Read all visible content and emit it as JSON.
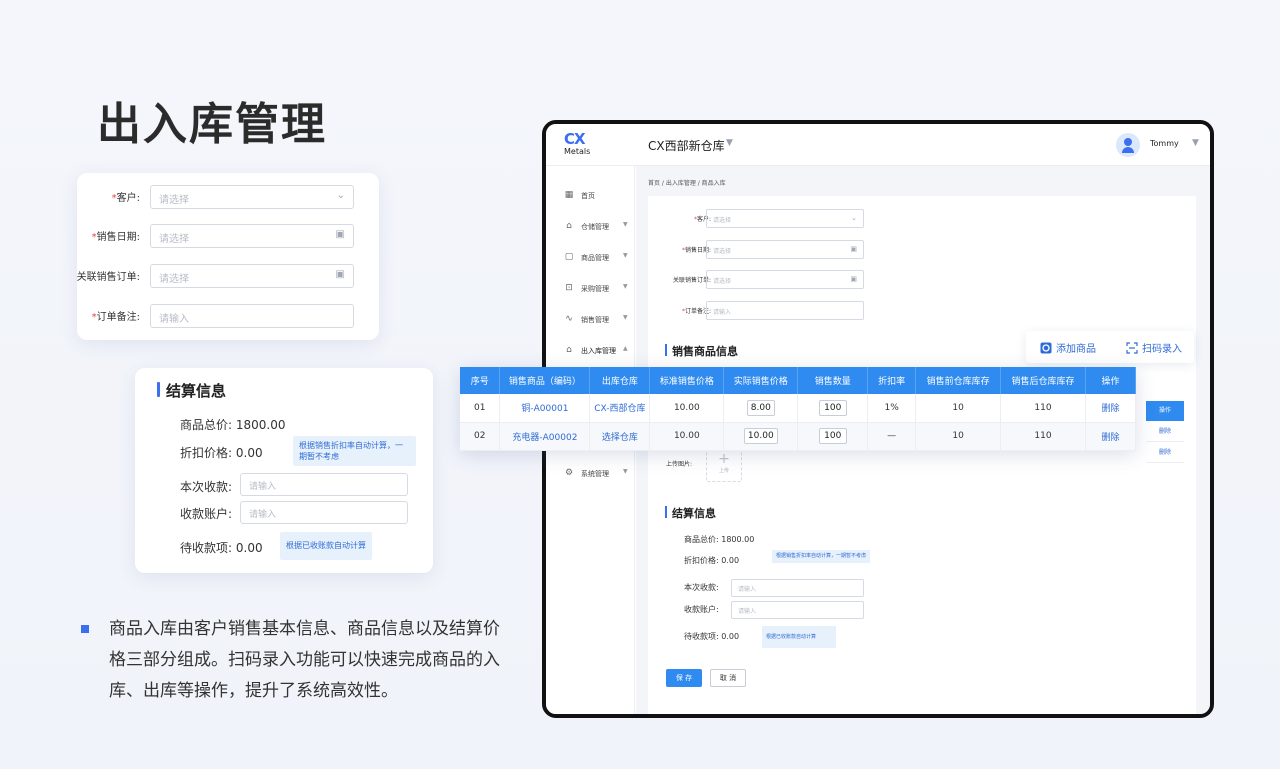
{
  "page_title": "出入库管理",
  "form_card": {
    "fields": [
      {
        "label": "客户:",
        "required": true,
        "placeholder": "请选择",
        "suffix_icon": "chevron-down-icon"
      },
      {
        "label": "销售日期:",
        "required": true,
        "placeholder": "请选择",
        "suffix_icon": "calendar-icon"
      },
      {
        "label": "关联销售订单:",
        "required": false,
        "placeholder": "请选择",
        "suffix_icon": "calendar-icon"
      },
      {
        "label": "订单备注:",
        "required": true,
        "placeholder": "请输入"
      }
    ]
  },
  "settle_card": {
    "title": "结算信息",
    "total_label": "商品总价:",
    "total_value": "1800.00",
    "discount_label": "折扣价格:",
    "discount_value": "0.00",
    "discount_hint": "根据销售折扣率自动计算，一期暂不考虑",
    "received_label": "本次收款:",
    "received_placeholder": "请输入",
    "account_label": "收款账户:",
    "account_placeholder": "请输入",
    "pending_label": "待收款项:",
    "pending_value": "0.00",
    "pending_hint": "根据已收账款自动计算"
  },
  "description": "商品入库由客户销售基本信息、商品信息以及结算价格三部分组成。扫码录入功能可以快速完成商品的入库、出库等操作，提升了系统高效性。",
  "app": {
    "logo_mark": "CX",
    "logo_text": "Metals",
    "warehouse": "CX西部新仓库",
    "user": "Tommy",
    "sidebar": [
      {
        "label": "首页",
        "icon": "grid-icon",
        "caret": false
      },
      {
        "label": "仓储管理",
        "icon": "warehouse-icon",
        "caret": true
      },
      {
        "label": "商品管理",
        "icon": "goods-icon",
        "caret": true
      },
      {
        "label": "采购管理",
        "icon": "cart-icon",
        "caret": true
      },
      {
        "label": "销售管理",
        "icon": "trend-icon",
        "caret": true
      },
      {
        "label": "出入库管理",
        "icon": "home-icon",
        "caret": true
      },
      {
        "label": "系统管理",
        "icon": "gear-icon",
        "caret": true
      }
    ],
    "breadcrumb": "首页 / 出入库管理 / 商品入库",
    "fields": [
      {
        "label": "客户:",
        "required": true,
        "placeholder": "请选择"
      },
      {
        "label": "销售日期:",
        "required": true,
        "placeholder": "请选择"
      },
      {
        "label": "关联销售订单:",
        "required": false,
        "placeholder": "请选择"
      },
      {
        "label": "订单备注:",
        "required": true,
        "placeholder": "请输入"
      }
    ],
    "goods_title": "销售商品信息",
    "upload_label": "上传图片:",
    "upload_text": "上传",
    "settle": {
      "title": "结算信息",
      "total_label": "商品总价:",
      "total_value": "1800.00",
      "discount_label": "折扣价格:",
      "discount_value": "0.00",
      "discount_hint": "根据销售折扣率自动计算，一期暂不考虑",
      "received_label": "本次收款:",
      "received_placeholder": "请输入",
      "account_label": "收款账户:",
      "account_placeholder": "请输入",
      "pending_label": "待收款项:",
      "pending_value": "0.00",
      "pending_hint": "根据已收账款自动计算"
    },
    "save": "保 存",
    "cancel": "取 消",
    "bg_table_header": "操作",
    "bg_table_action": "删除"
  },
  "toolbar": {
    "add": "添加商品",
    "scan": "扫码录入"
  },
  "goods_table": {
    "headers": [
      "序号",
      "销售商品（编码）",
      "出库仓库",
      "标准销售价格",
      "实际销售价格",
      "销售数量",
      "折扣率",
      "销售前仓库库存",
      "销售后仓库库存",
      "操作"
    ],
    "rows": [
      {
        "no": "01",
        "item": "铜-A00001",
        "warehouse": "CX-西部仓库",
        "std_price": "10.00",
        "actual_price": "8.00",
        "qty": "100",
        "discount": "1%",
        "stock_before": "10",
        "stock_after": "110",
        "action": "删除"
      },
      {
        "no": "02",
        "item": "充电器-A00002",
        "warehouse": "选择仓库",
        "std_price": "10.00",
        "actual_price": "10.00",
        "qty": "100",
        "discount": "—",
        "stock_before": "10",
        "stock_after": "110",
        "action": "删除"
      }
    ]
  },
  "colors": {
    "accent": "#2f8bef",
    "brand": "#3a6ff0",
    "required": "#e54545",
    "hint_bg": "#e7f1fc"
  }
}
